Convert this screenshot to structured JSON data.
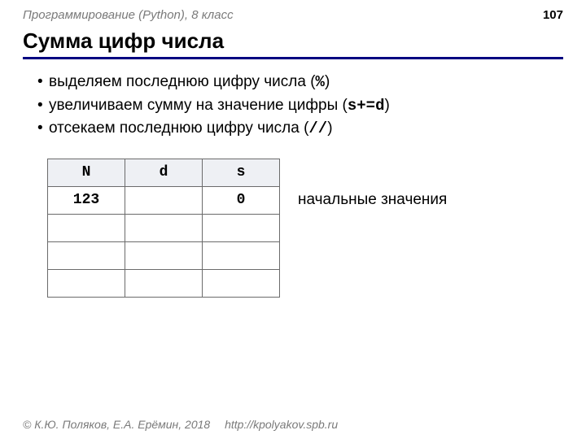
{
  "header": {
    "course_label": "Программирование (Python), 8 класс",
    "page_number": "107"
  },
  "title": "Сумма цифр числа",
  "bullets": [
    {
      "pre": "выделяем последнюю цифру числа (",
      "code": "%",
      "post": ")"
    },
    {
      "pre": "увеличиваем сумму на значение цифры (",
      "code": "s+=d",
      "post": ")"
    },
    {
      "pre": "отсекаем последнюю цифру числа (",
      "code": "//",
      "post": ")"
    }
  ],
  "table": {
    "headers": [
      "N",
      "d",
      "s"
    ],
    "rows": [
      [
        "123",
        "",
        "0"
      ],
      [
        "",
        "",
        ""
      ],
      [
        "",
        "",
        ""
      ],
      [
        "",
        "",
        ""
      ]
    ],
    "side_label": "начальные значения"
  },
  "footer": {
    "copyright": "© К.Ю. Поляков, Е.А. Ерёмин, 2018",
    "url": "http://kpolyakov.spb.ru"
  }
}
